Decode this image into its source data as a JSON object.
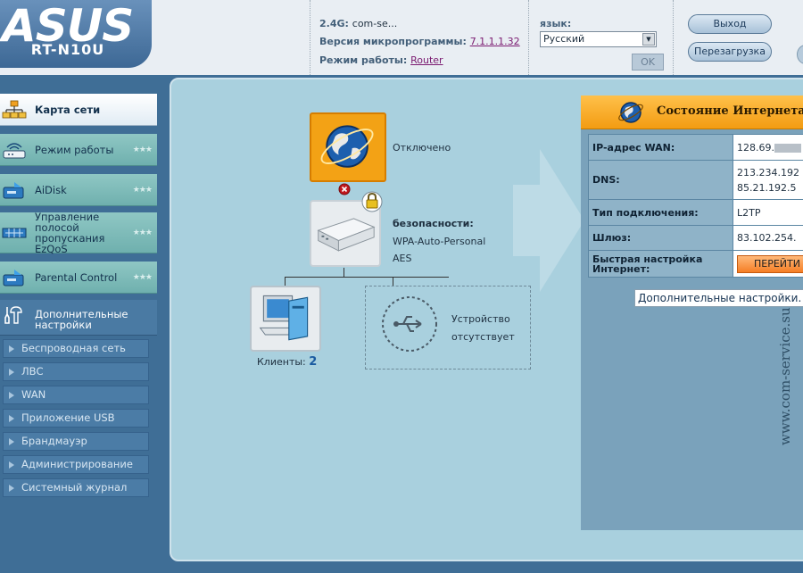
{
  "header": {
    "brand": "ASUS",
    "model": "RT-N10U",
    "ssid_label": "2.4G:",
    "ssid_value": "com-se...",
    "firmware_label": "Версия микропрограммы:",
    "firmware_value": "7.1.1.1.32",
    "mode_label": "Режим работы:",
    "mode_value": "Router",
    "language_label": "язык:",
    "language_selected": "Русский",
    "ok_label": "OK",
    "logout_label": "Выход",
    "reboot_label": "Перезагрузка"
  },
  "sidebar": {
    "items": [
      {
        "label": "Карта сети",
        "icon": "network-map-icon"
      },
      {
        "label": "Режим работы",
        "icon": "router-mode-icon"
      },
      {
        "label": "AiDisk",
        "icon": "aidisk-icon"
      },
      {
        "label": "Управление полосой пропускания EzQoS",
        "icon": "qos-icon"
      },
      {
        "label": "Parental Control",
        "icon": "parental-control-icon"
      }
    ],
    "advanced_label": "Дополнительные настройки",
    "sub_items": [
      "Беспроводная сеть",
      "ЛВС",
      "WAN",
      "Приложение USB",
      "Брандмауэр",
      "Администрирование",
      "Системный журнал"
    ]
  },
  "network_map": {
    "internet_status": "Отключено",
    "security_label": "безопасности:",
    "security_auth": "WPA-Auto-Personal",
    "security_enc": "AES",
    "clients_label": "Клиенты:",
    "clients_count": "2",
    "usb_line1": "Устройство",
    "usb_line2": "отсутствует"
  },
  "internet_panel": {
    "title": "Состояние Интернета",
    "rows": [
      {
        "label": "IP-адрес WAN:",
        "value": "128.69."
      },
      {
        "label": "DNS:",
        "value": "213.234.192",
        "value2": "85.21.192.5"
      },
      {
        "label": "Тип подключения:",
        "value": "L2TP"
      },
      {
        "label": "Шлюз:",
        "value": "83.102.254."
      },
      {
        "label": "Быстрая настройка Интернет:",
        "value": "ПЕРЕЙТИ"
      }
    ],
    "advanced_select": "Дополнительные настройки."
  },
  "watermark": "www.com-service.su",
  "colors": {
    "accent": "#f39c12",
    "sidebar_bg": "#3f6e96",
    "menu_teal": "#7fbcba",
    "panel_bg": "#a9d0de"
  }
}
